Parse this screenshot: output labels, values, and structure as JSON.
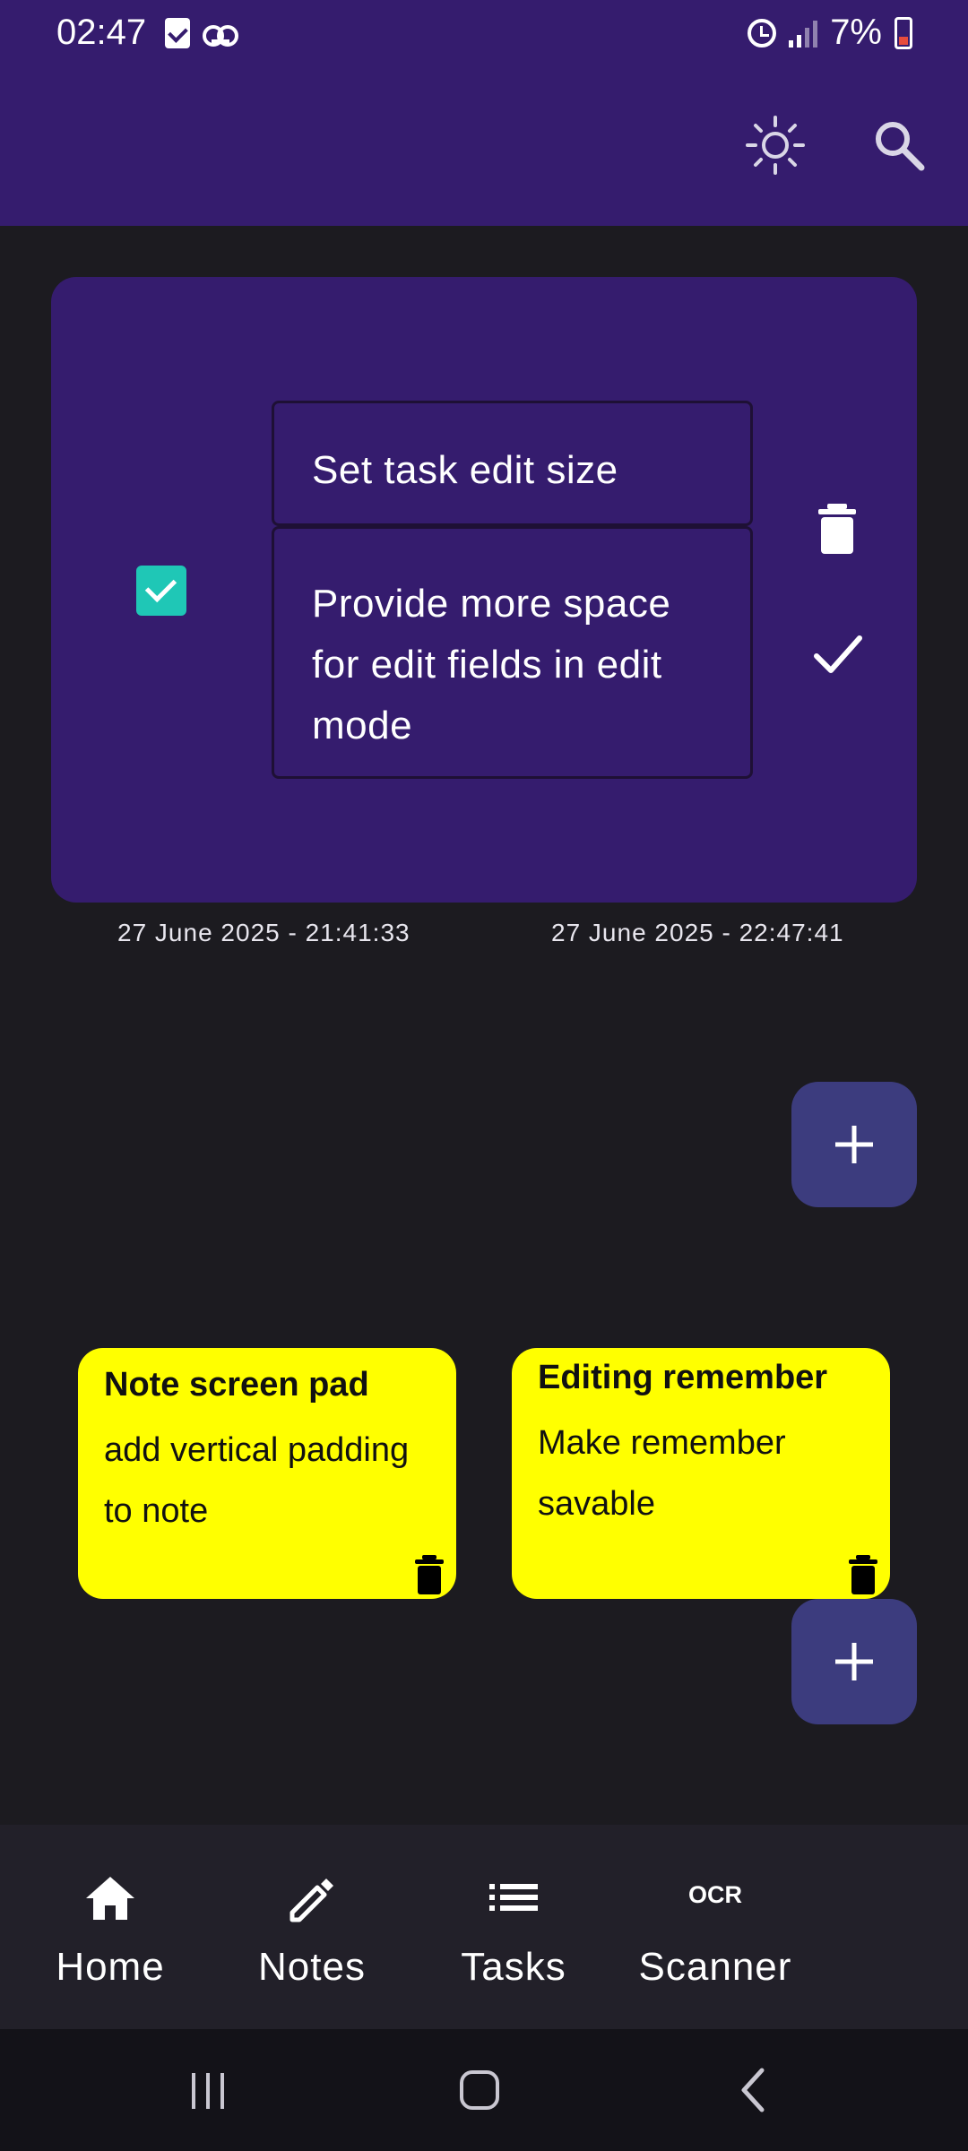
{
  "status_bar": {
    "time": "02:47",
    "battery": "7%",
    "icons": [
      "task-check-icon",
      "voicemail-icon",
      "alarm-icon",
      "signal-icon",
      "battery-low-icon"
    ]
  },
  "app_bar": {
    "icons": [
      "brightness-icon",
      "search-icon"
    ]
  },
  "task": {
    "completed": true,
    "title": "Set task edit size",
    "description": "Provide more space for edit fields in edit mode",
    "created": "27 June 2025 - 21:41:33",
    "modified": "27 June 2025 - 22:47:41"
  },
  "notes": [
    {
      "title": "Note screen pad",
      "body": "add vertical padding to note"
    },
    {
      "title": "Editing remember",
      "body": "Make remember savable"
    }
  ],
  "bottom_nav": {
    "items": [
      {
        "label": "Home",
        "icon": "home-icon"
      },
      {
        "label": "Notes",
        "icon": "pencil-icon"
      },
      {
        "label": "Tasks",
        "icon": "list-icon"
      },
      {
        "label": "Scanner",
        "icon": "ocr-icon",
        "icon_text": "OCR"
      }
    ]
  },
  "colors": {
    "primary": "#351c6e",
    "background": "#1c1b20",
    "checkbox": "#1fc7b6",
    "note": "#ffff00",
    "fab": "#3c3c7e"
  }
}
